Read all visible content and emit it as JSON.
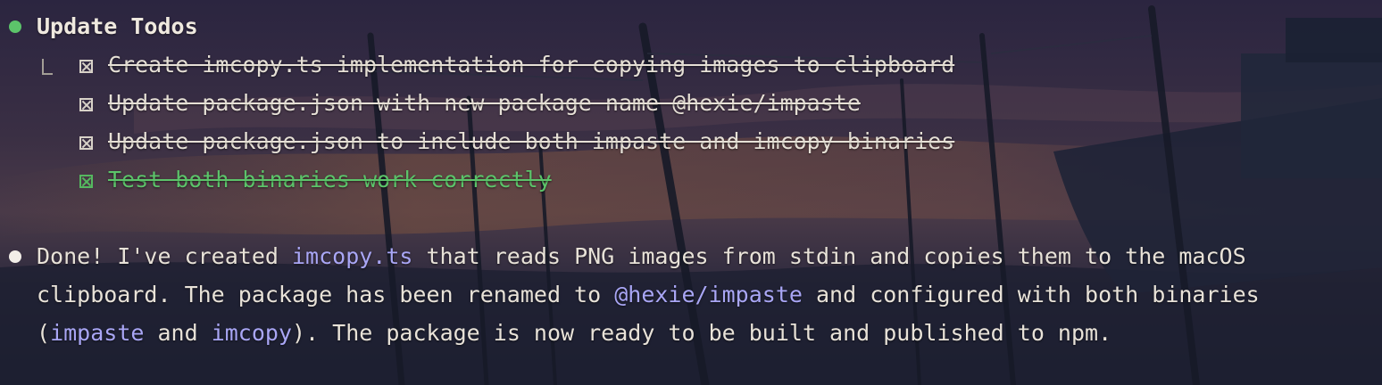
{
  "update_todos": {
    "title": "Update Todos",
    "items": [
      {
        "text": "Create imcopy.ts implementation for copying images to clipboard",
        "status": "completed"
      },
      {
        "text": "Update package.json with new package name @hexie/impaste",
        "status": "completed"
      },
      {
        "text": "Update package.json to include both impaste and imcopy binaries",
        "status": "completed"
      },
      {
        "text": "Test both binaries work correctly",
        "status": "completed"
      }
    ]
  },
  "message": {
    "line1": {
      "a": "Done! I've created ",
      "code1": "imcopy.ts",
      "b": " that reads PNG images from stdin and copies them to the macOS"
    },
    "line2": {
      "a": "clipboard. The package has been renamed to ",
      "code1": "@hexie/impaste",
      "b": " and configured with both binaries"
    },
    "line3": {
      "a": "(",
      "code1": "impaste",
      "b": " and ",
      "code2": "imcopy",
      "c": "). The package is now ready to be built and published to npm."
    }
  },
  "colors": {
    "accent_green": "#5cc46a",
    "code_purple": "#a9a6f5",
    "text": "#e8e2d8"
  },
  "icons": {
    "todo_status": "checkbox-crossed-icon",
    "tree_connector": "elbow-connector-icon",
    "bullet": "dot-icon"
  }
}
